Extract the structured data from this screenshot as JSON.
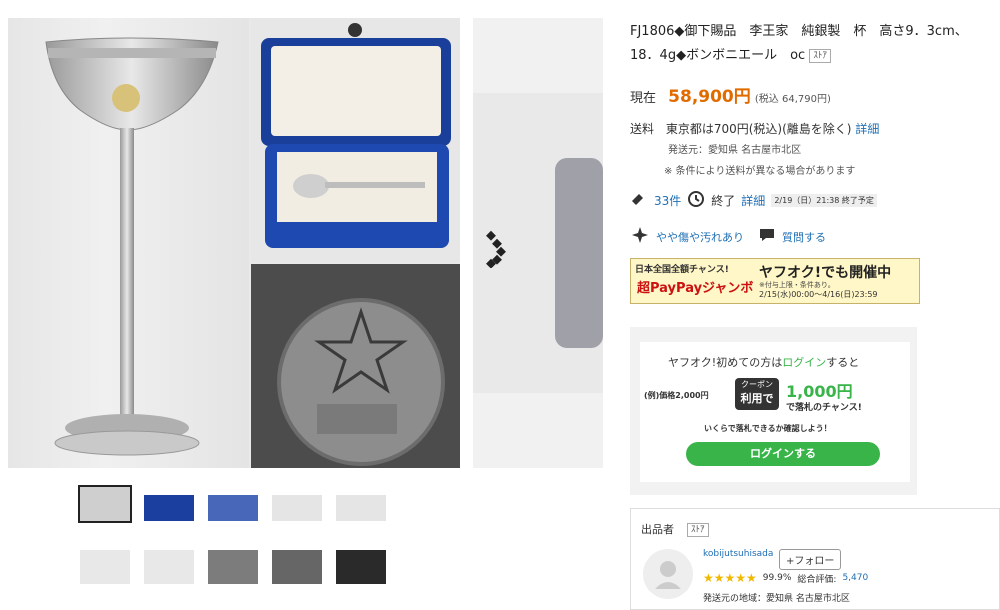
{
  "title": "FJ1806◆御下賜品　李王家　純銀製　杯　高さ9．3cm、18．4g◆ボンボニエール　oc",
  "title_badge": "ｽﾄｱ",
  "price": {
    "label": "現在",
    "value": "58,900円",
    "tax": "(税込 64,790円)"
  },
  "shipping": {
    "label": "送料",
    "text": "東京都は700円(税込)(離島を除く)",
    "detail_link": "詳細",
    "origin": "発送元：愛知県 名古屋市北区",
    "note": "※ 条件により送料が異なる場合があります"
  },
  "meta": {
    "bids": "33件",
    "status": "終了",
    "detail": "詳細",
    "end_time": "2/19（日）21:38 終了予定"
  },
  "condition": {
    "text": "やや傷や汚れあり",
    "question": "質問する"
  },
  "banner": {
    "left_top": "日本全国全額チャンス!",
    "left_bottom": "超PayPayジャンボ",
    "right_top": "ヤフオク!でも開催中",
    "right_note": "※付与上限・条件あり。",
    "period": "2/15(水)00:00～4/16(日)23:59"
  },
  "login_card": {
    "headline_prefix": "ヤフオク!初めての方は",
    "headline_link": "ログイン",
    "headline_suffix": "すると",
    "example": "(例)価格2,000円",
    "coupon_top": "クーポン",
    "coupon_bottom": "利用で",
    "coupon_value": "1,000円",
    "coupon_suffix": "で落札のチャンス!",
    "sub": "いくらで落札できるか確認しよう！",
    "button": "ログインする"
  },
  "seller": {
    "label": "出品者",
    "badge": "ｽﾄｱ",
    "name": "kobijutsuhisada",
    "follow": "+フォロー",
    "rating_pct": "99.9%",
    "rating_label": "総合評価:",
    "rating_count": "5,470",
    "location": "発送元の地域：愛知県 名古屋市北区"
  },
  "colors": {
    "price": "#e26b00",
    "link": "#1f6fb5",
    "green": "#38b449"
  }
}
